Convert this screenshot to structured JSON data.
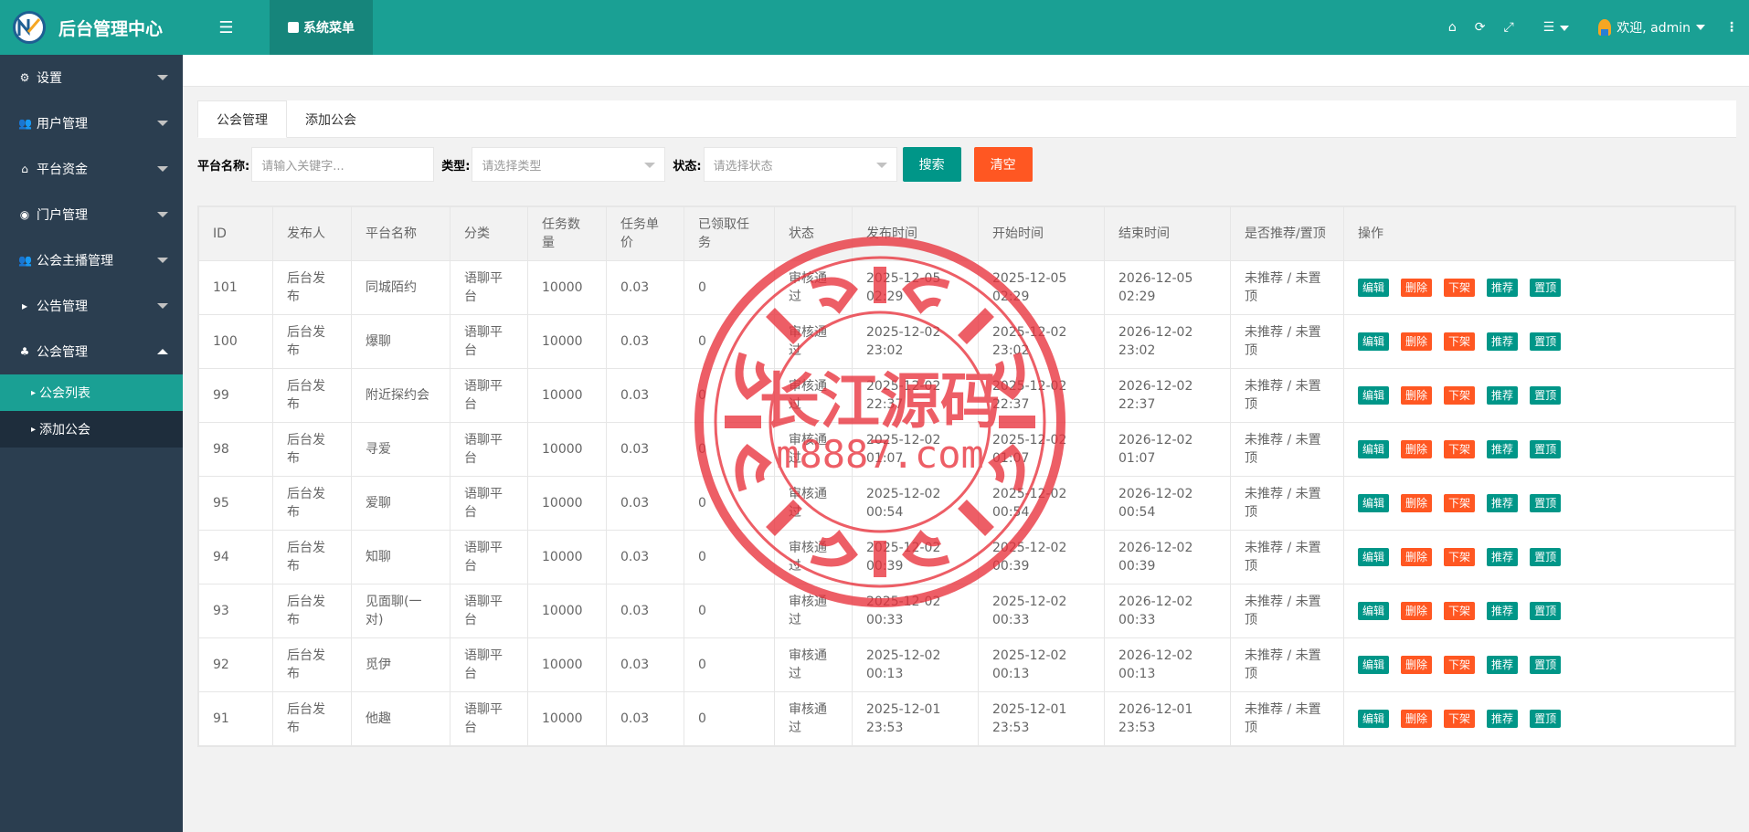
{
  "app": {
    "title": "后台管理中心"
  },
  "header": {
    "system_menu_label": "系统菜单",
    "welcome_label": "欢迎, admin"
  },
  "sidebar": {
    "items": [
      {
        "label": "设置",
        "icon": "gears-icon"
      },
      {
        "label": "用户管理",
        "icon": "users-icon"
      },
      {
        "label": "平台资金",
        "icon": "bank-icon"
      },
      {
        "label": "门户管理",
        "icon": "globe-icon"
      },
      {
        "label": "公会主播管理",
        "icon": "users-icon"
      },
      {
        "label": "公告管理",
        "icon": "caret-right-icon"
      },
      {
        "label": "公会管理",
        "icon": "tree-icon"
      }
    ],
    "submenu": [
      {
        "label": "公会列表",
        "active": true
      },
      {
        "label": "添加公会",
        "active": false
      }
    ]
  },
  "tabs": [
    {
      "label": "公会管理",
      "active": true
    },
    {
      "label": "添加公会",
      "active": false
    }
  ],
  "search": {
    "name_label": "平台名称:",
    "name_placeholder": "请输入关键字...",
    "type_label": "类型:",
    "type_placeholder": "请选择类型",
    "status_label": "状态:",
    "status_placeholder": "请选择状态",
    "search_button": "搜索",
    "clear_button": "清空"
  },
  "table": {
    "headers": [
      "ID",
      "发布人",
      "平台名称",
      "分类",
      "任务数量",
      "任务单价",
      "已领取任务",
      "状态",
      "发布时间",
      "开始时间",
      "结束时间",
      "是否推荐/置顶",
      "操作"
    ],
    "actions": [
      "编辑",
      "删除",
      "下架",
      "推荐",
      "置顶"
    ],
    "rows": [
      [
        "101",
        "后台发布",
        "同城陌约",
        "语聊平台",
        "10000",
        "0.03",
        "0",
        "审核通过",
        "2025-12-05 02:29",
        "2025-12-05 02:29",
        "2026-12-05 02:29",
        "未推荐 / 未置顶"
      ],
      [
        "100",
        "后台发布",
        "爆聊",
        "语聊平台",
        "10000",
        "0.03",
        "0",
        "审核通过",
        "2025-12-02 23:02",
        "2025-12-02 23:02",
        "2026-12-02 23:02",
        "未推荐 / 未置顶"
      ],
      [
        "99",
        "后台发布",
        "附近探约会",
        "语聊平台",
        "10000",
        "0.03",
        "0",
        "审核通过",
        "2025-12-02 22:37",
        "2025-12-02 22:37",
        "2026-12-02 22:37",
        "未推荐 / 未置顶"
      ],
      [
        "98",
        "后台发布",
        "寻爱",
        "语聊平台",
        "10000",
        "0.03",
        "0",
        "审核通过",
        "2025-12-02 01:07",
        "2025-12-02 01:07",
        "2026-12-02 01:07",
        "未推荐 / 未置顶"
      ],
      [
        "95",
        "后台发布",
        "爱聊",
        "语聊平台",
        "10000",
        "0.03",
        "0",
        "审核通过",
        "2025-12-02 00:54",
        "2025-12-02 00:54",
        "2026-12-02 00:54",
        "未推荐 / 未置顶"
      ],
      [
        "94",
        "后台发布",
        "知聊",
        "语聊平台",
        "10000",
        "0.03",
        "0",
        "审核通过",
        "2025-12-02 00:39",
        "2025-12-02 00:39",
        "2026-12-02 00:39",
        "未推荐 / 未置顶"
      ],
      [
        "93",
        "后台发布",
        "见面聊(一对)",
        "语聊平台",
        "10000",
        "0.03",
        "0",
        "审核通过",
        "2025-12-02 00:33",
        "2025-12-02 00:33",
        "2026-12-02 00:33",
        "未推荐 / 未置顶"
      ],
      [
        "92",
        "后台发布",
        "觅伊",
        "语聊平台",
        "10000",
        "0.03",
        "0",
        "审核通过",
        "2025-12-02 00:13",
        "2025-12-02 00:13",
        "2026-12-02 00:13",
        "未推荐 / 未置顶"
      ],
      [
        "91",
        "后台发布",
        "他趣",
        "语聊平台",
        "10000",
        "0.03",
        "0",
        "审核通过",
        "2025-12-01 23:53",
        "2025-12-01 23:53",
        "2026-12-01 23:53",
        "未推荐 / 未置顶"
      ]
    ]
  },
  "watermark": {
    "line1": "长江源码",
    "line2": "m8887.com"
  },
  "colors": {
    "primary": "#1aa094",
    "sidebar": "#2b3e50",
    "danger": "#ff5722",
    "button_green": "#009688"
  }
}
